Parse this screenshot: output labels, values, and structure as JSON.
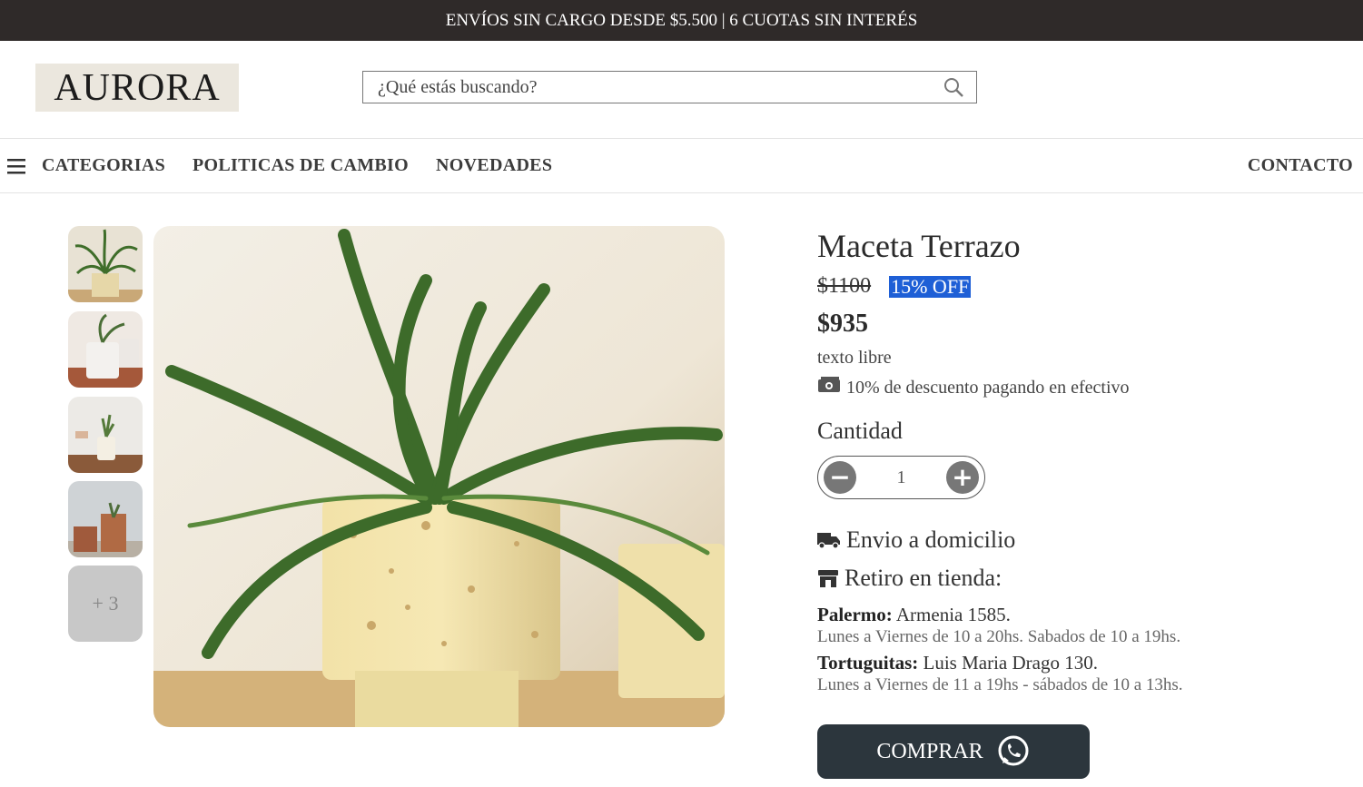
{
  "announcement": "ENVÍOS SIN CARGO DESDE $5.500 | 6 CUOTAS SIN INTERÉS",
  "logo": {
    "text": "AURORA"
  },
  "search": {
    "placeholder": "¿Qué estás buscando?",
    "icon": "search-icon"
  },
  "nav": {
    "menu_icon": "hamburger-icon",
    "items": [
      "CATEGORIAS",
      "POLITICAS DE CAMBIO",
      "NOVEDADES"
    ],
    "contact": "CONTACTO"
  },
  "gallery": {
    "more_label": "+ 3"
  },
  "product": {
    "title": "Maceta Terrazo",
    "old_price": "$1100",
    "discount_badge": "15% OFF",
    "price": "$935",
    "free_text": "texto libre",
    "cash_discount": "10% de descuento pagando en efectivo",
    "quantity_label": "Cantidad",
    "quantity": "1",
    "shipping_label": "Envio a domicilio",
    "pickup_label": "Retiro en tienda:",
    "stores": [
      {
        "name": "Palermo:",
        "address": "Armenia 1585.",
        "hours": "Lunes a Viernes de 10 a 20hs. Sabados de 10 a 19hs."
      },
      {
        "name": "Tortuguitas:",
        "address": "Luis Maria Drago 130.",
        "hours": "Lunes a Viernes de 11 a 19hs - sábados de 10 a 13hs."
      }
    ],
    "buy_label": "COMPRAR"
  },
  "colors": {
    "topbar": "#2f2a29",
    "badge": "#1e5fd6",
    "buy_button": "#2c363d"
  }
}
